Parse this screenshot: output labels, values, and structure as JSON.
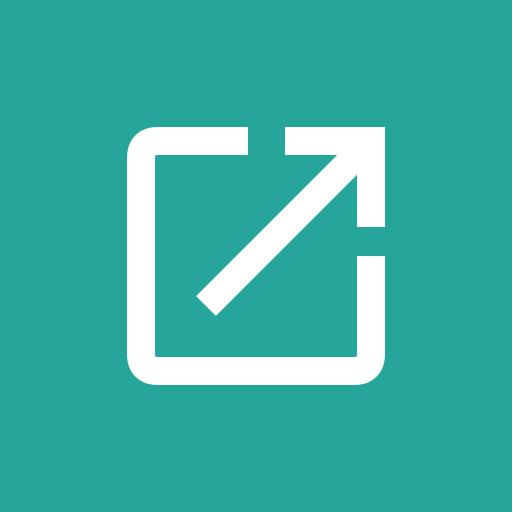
{
  "app_icon": {
    "icon_name": "open-in-new-icon",
    "colors": {
      "background": "#26A69A",
      "foreground": "#FFFFFF"
    }
  }
}
